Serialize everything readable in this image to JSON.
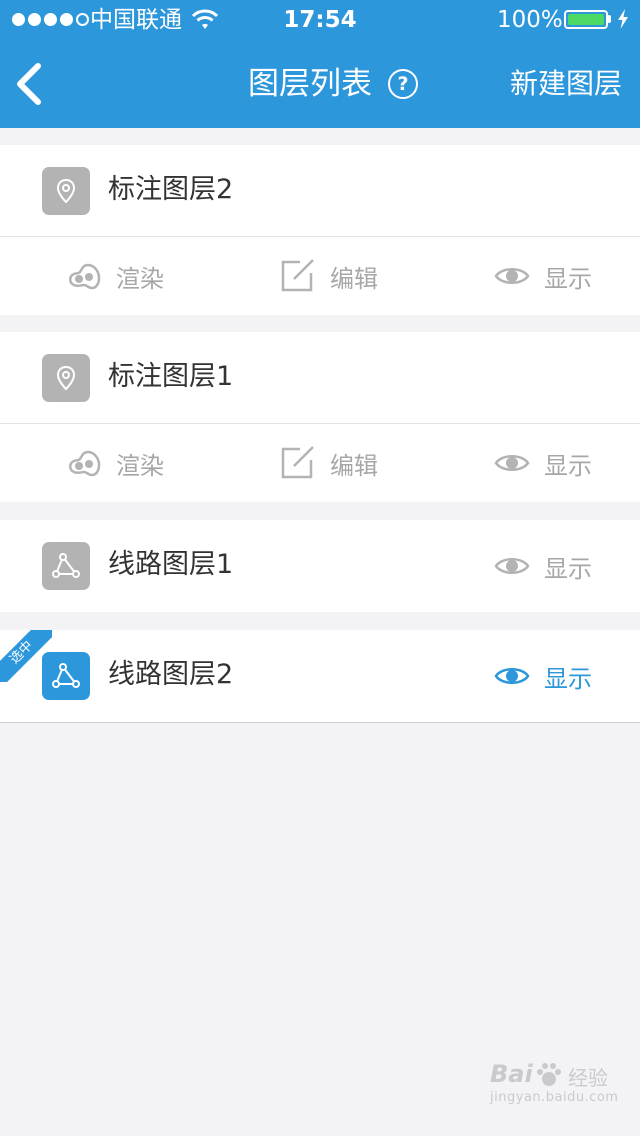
{
  "status_bar": {
    "carrier": "中国联通",
    "time": "17:54",
    "battery_percent": "100%"
  },
  "nav": {
    "title": "图层列表",
    "help_glyph": "?",
    "new_layer_label": "新建图层"
  },
  "layers": [
    {
      "name": "标注图层2",
      "icon": "map-pin-icon",
      "render_label": "渲染",
      "edit_label": "编辑",
      "show_label": "显示"
    },
    {
      "name": "标注图层1",
      "icon": "map-pin-icon",
      "render_label": "渲染",
      "edit_label": "编辑",
      "show_label": "显示"
    },
    {
      "name": "线路图层1",
      "icon": "route-icon",
      "show_label": "显示"
    },
    {
      "name": "线路图层2",
      "icon": "route-icon",
      "show_label": "显示",
      "selected_tag": "选中"
    }
  ],
  "watermark": {
    "brand": "Bai",
    "sub": "经验",
    "url": "jingyan.baidu.com"
  },
  "colors": {
    "accent": "#2d97dc",
    "icon_gray": "#b3b3b3",
    "action_gray": "#a7a7a7",
    "battery_green": "#4cd964"
  }
}
